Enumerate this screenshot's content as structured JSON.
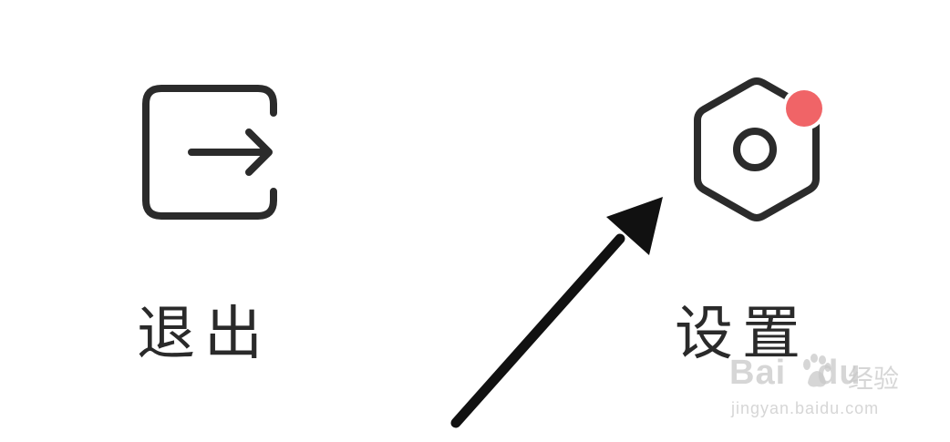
{
  "menu": {
    "items": [
      {
        "id": "exit",
        "label": "退出",
        "icon": "exit-icon"
      },
      {
        "id": "settings",
        "label": "设置",
        "icon": "settings-icon",
        "badge": "notification-dot"
      }
    ]
  },
  "colors": {
    "icon": "#2b2b2b",
    "badge": "#f06467",
    "arrow": "#111111",
    "watermark": "#c8c8c8"
  },
  "watermark": {
    "brand_left": "Bai",
    "brand_right": "du",
    "brand_cn": "经验",
    "url": "jingyan.baidu.com"
  }
}
